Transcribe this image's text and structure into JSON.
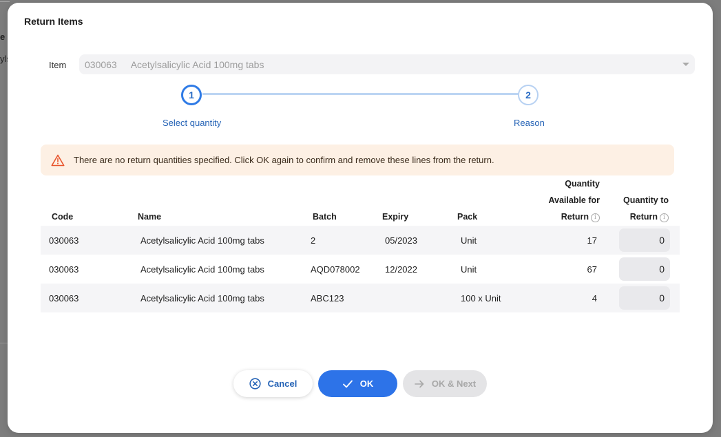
{
  "backdrop": {
    "text1": "e",
    "text2": "yls"
  },
  "dialog": {
    "title": "Return Items",
    "item": {
      "label": "Item",
      "code": "030063",
      "name": "Acetylsalicylic Acid 100mg tabs"
    },
    "stepper": {
      "steps": [
        {
          "number": "1",
          "label": "Select quantity",
          "active": true
        },
        {
          "number": "2",
          "label": "Reason",
          "active": false
        }
      ]
    },
    "alert": {
      "icon": "warning-triangle-icon",
      "color": "#e8542c",
      "message": "There are no return quantities specified. Click OK again to confirm and remove these lines from the return."
    },
    "table": {
      "columns": {
        "code": "Code",
        "name": "Name",
        "batch": "Batch",
        "expiry": "Expiry",
        "pack": "Pack",
        "available": [
          "Quantity",
          "Available for",
          "Return"
        ],
        "to_return": [
          "Quantity to",
          "Return"
        ]
      },
      "rows": [
        {
          "code": "030063",
          "name": "Acetylsalicylic Acid 100mg tabs",
          "batch": "2",
          "expiry": "05/2023",
          "pack": "Unit",
          "available": "17",
          "to_return": "0"
        },
        {
          "code": "030063",
          "name": "Acetylsalicylic Acid 100mg tabs",
          "batch": "AQD078002",
          "expiry": "12/2022",
          "pack": "Unit",
          "available": "67",
          "to_return": "0"
        },
        {
          "code": "030063",
          "name": "Acetylsalicylic Acid 100mg tabs",
          "batch": "ABC123",
          "expiry": "",
          "pack": "100 x Unit",
          "available": "4",
          "to_return": "0"
        }
      ]
    },
    "buttons": {
      "cancel": {
        "label": "Cancel",
        "icon": "x-circle-icon"
      },
      "ok": {
        "label": "OK",
        "icon": "checkmark-icon"
      },
      "ok_next": {
        "label": "OK & Next",
        "icon": "arrow-right-icon",
        "disabled": true
      }
    },
    "colors": {
      "primary": "#2d73e8",
      "alert_bg": "#fdf0e4"
    }
  }
}
